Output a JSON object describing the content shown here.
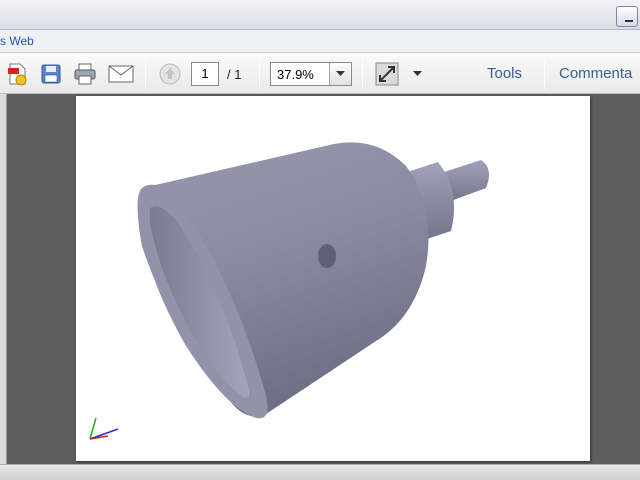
{
  "menubar": {
    "items": [
      {
        "label": "s Web"
      }
    ]
  },
  "toolbar": {
    "icons": [
      "create-pdf-icon",
      "save-icon",
      "print-icon",
      "email-icon",
      "previous-page-icon",
      "fit-page-icon",
      "chevron-down-icon"
    ],
    "page_current": "1",
    "page_total": "/ 1",
    "zoom": "37.9%",
    "tools_label": "Tools",
    "comment_label": "Commenta"
  },
  "document": {
    "axis_indicator": "xyz-axis-icon",
    "model": "3d-model-view"
  },
  "colors": {
    "link": "#3a5f8f",
    "menu_link": "#2255aa",
    "viewport_background": "#5e5e5e",
    "model": "#8c8ca4"
  }
}
